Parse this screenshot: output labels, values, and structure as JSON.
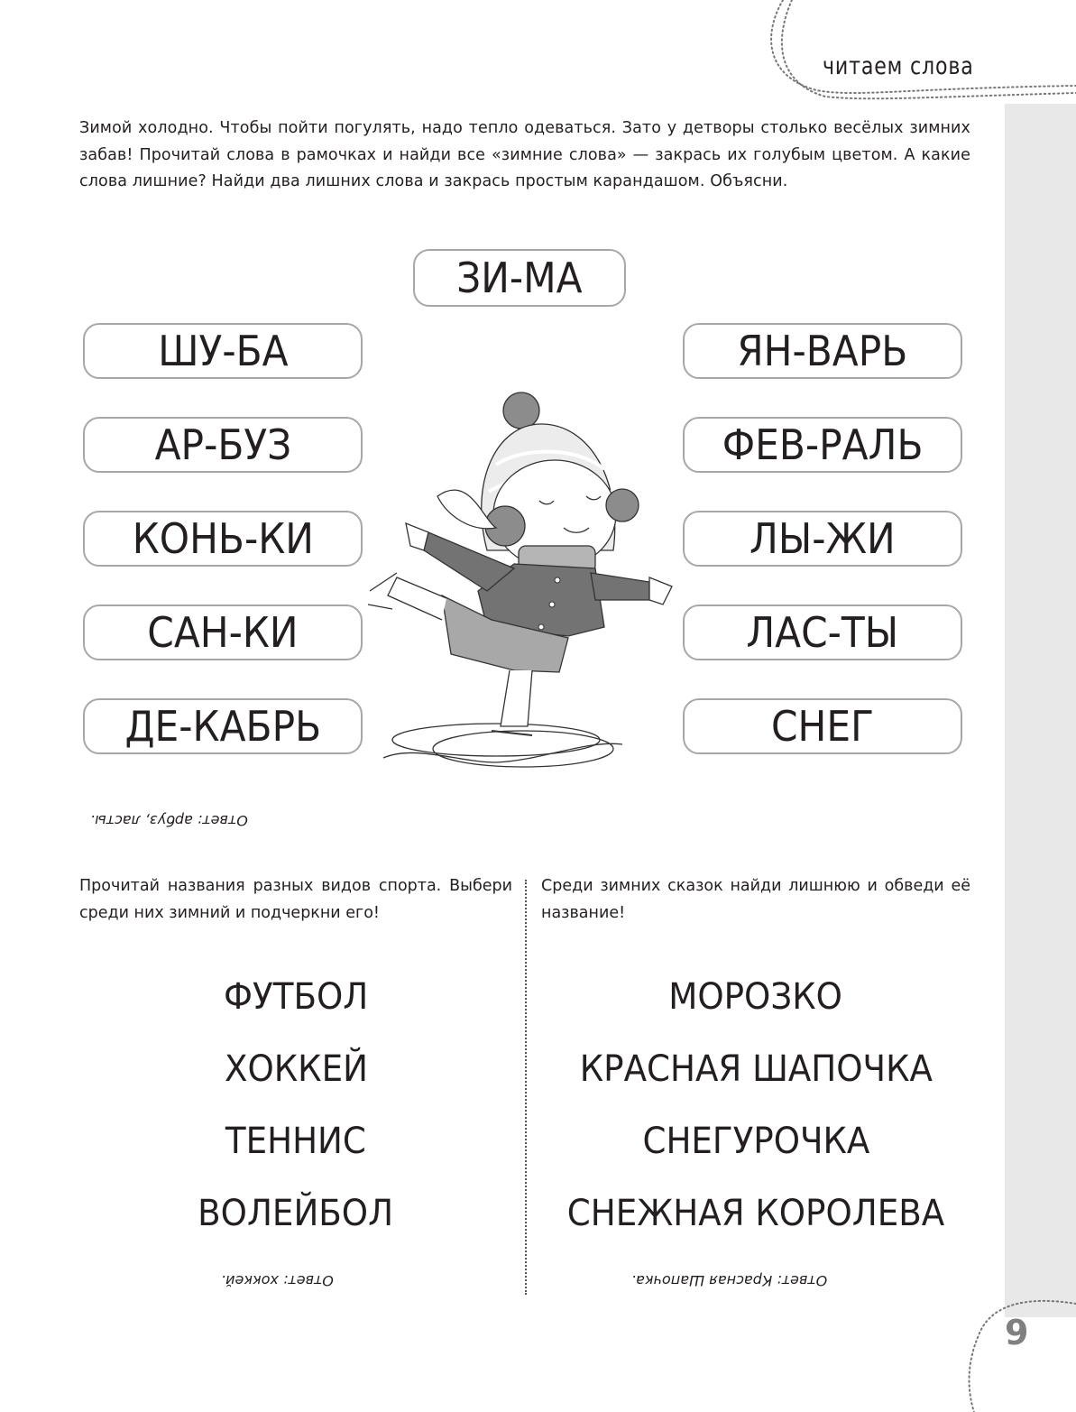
{
  "header": {
    "section_title": "читаем слова"
  },
  "intro_text": "Зимой холодно. Чтобы пойти погулять, надо тепло одеваться. Зато у детворы столько весёлых зимних забав! Прочитай слова в рамочках и найди все «зимние слова» — закрась их голубым цветом. А какие слова лишние? Найди два лишних слова и закрась простым карандашом. Объясни.",
  "word_boxes": {
    "top": "ЗИ-МА",
    "left": [
      "ШУ-БА",
      "АР-БУЗ",
      "КОНЬ-КИ",
      "САН-КИ",
      "ДЕ-КАБРЬ"
    ],
    "right": [
      "ЯН-ВАРЬ",
      "ФЕВ-РАЛЬ",
      "ЛЫ-ЖИ",
      "ЛАС-ТЫ",
      "СНЕГ"
    ]
  },
  "answer_1": "Ответ: арбуз, ласты.",
  "sports_task": {
    "instruction": "Прочитай названия разных видов спорта. Выбери среди них зимний и подчеркни его!",
    "items": [
      "ФУТБОЛ",
      "ХОККЕЙ",
      "ТЕННИС",
      "ВОЛЕЙБОЛ"
    ],
    "answer": "Ответ: хоккей."
  },
  "tales_task": {
    "instruction": "Среди зимних сказок найди лишнюю и обведи её название!",
    "items": [
      "МОРОЗКО",
      "КРАСНАЯ ШАПОЧКА",
      "СНЕГУРОЧКА",
      "СНЕЖНАЯ КОРОЛЕВА"
    ],
    "answer": "Ответ: Красная Шапочка."
  },
  "page_number": "9",
  "colors": {
    "text": "#231f20",
    "box_border": "#a7a7a7",
    "side_strip": "#e8e8e8",
    "page_number": "#808080"
  }
}
